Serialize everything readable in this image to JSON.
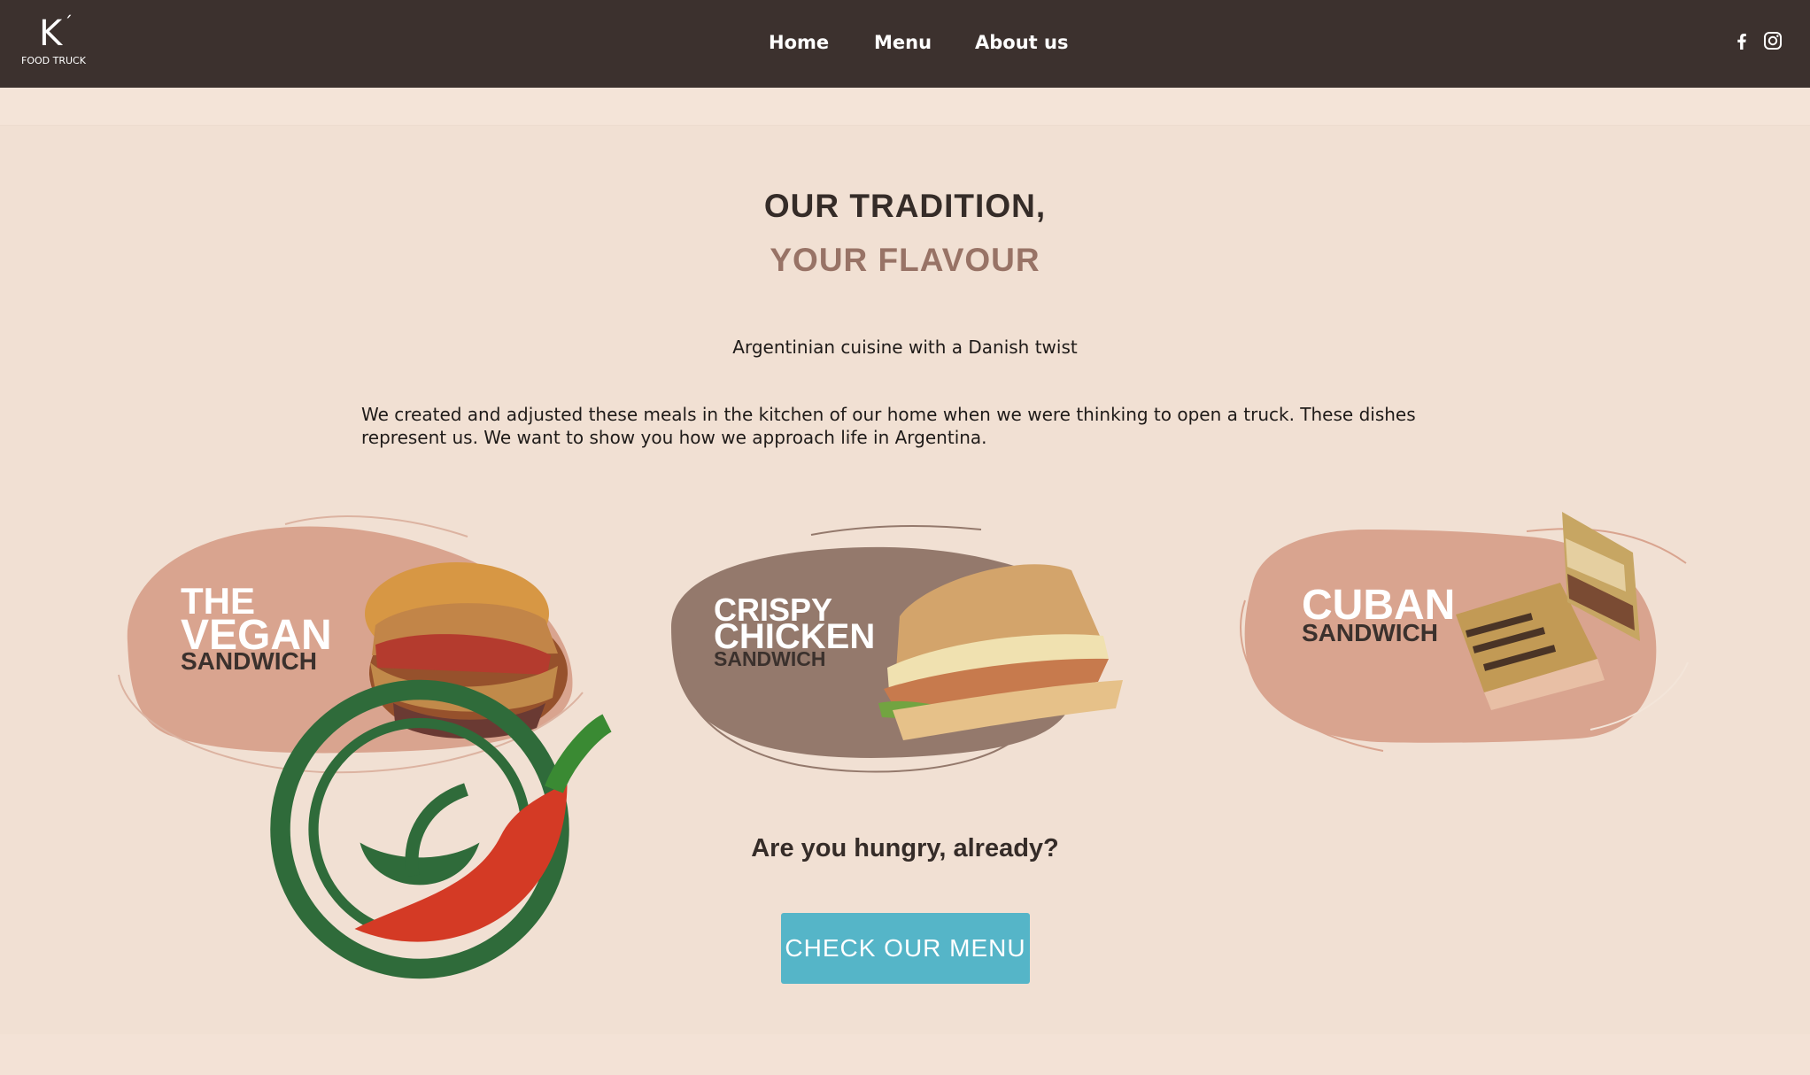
{
  "nav": {
    "logo_letter": "K",
    "logo_accent": "´",
    "logo_subtitle": "FOOD TRUCK",
    "links": [
      {
        "label": "Home"
      },
      {
        "label": "Menu"
      },
      {
        "label": "About us"
      }
    ],
    "social_icons": [
      "facebook-icon",
      "instagram-icon"
    ]
  },
  "hero": {
    "heading_line1": "OUR TRADITION,",
    "heading_line2": "YOUR FLAVOUR",
    "tagline": "Argentinian cuisine with a Danish twist",
    "intro": "We created and adjusted these meals in the kitchen of our home when we were thinking to open a truck. These dishes represent us. We want to show you how we approach life in Argentina."
  },
  "cards": [
    {
      "title_lines": [
        "THE",
        "VEGAN",
        "SANDWICH"
      ],
      "badges": [
        "vegan-badge-icon",
        "chili-icon"
      ],
      "image": "vegan-sandwich-image",
      "blob_color": "#d9a48f"
    },
    {
      "title_lines": [
        "CRISPY",
        "CHICKEN",
        "SANDWICH"
      ],
      "image": "crispy-chicken-sandwich-image",
      "blob_color": "#94796c"
    },
    {
      "title_lines": [
        "CUBAN",
        "SANDWICH"
      ],
      "image": "cuban-sandwich-image",
      "blob_color": "#d9a48f"
    }
  ],
  "cta": {
    "heading": "Are you hungry, already?",
    "button_label": "CHECK OUR MENU"
  },
  "colors": {
    "nav_bg": "#3c312e",
    "page_bg": "#f1e0d3",
    "accent_brown": "#987366",
    "button_bg": "#55b5c8"
  }
}
